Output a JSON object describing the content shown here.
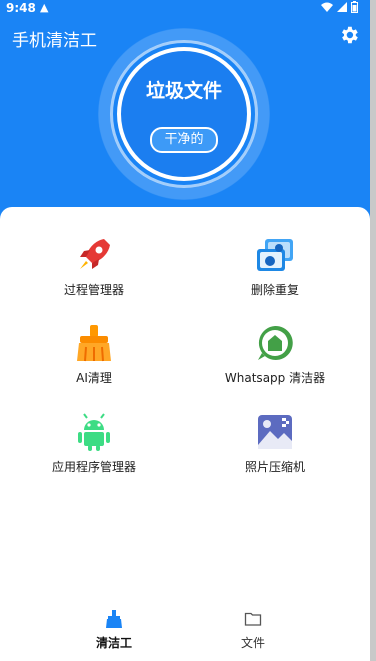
{
  "status": {
    "time": "9:48",
    "alert": "▲"
  },
  "app": {
    "title": "手机清洁工"
  },
  "hero": {
    "title": "垃圾文件",
    "status": "干净的"
  },
  "tools": [
    {
      "label": "过程管理器",
      "icon": "rocket-icon"
    },
    {
      "label": "删除重复",
      "icon": "duplicate-images-icon"
    },
    {
      "label": "AI清理",
      "icon": "broom-icon"
    },
    {
      "label": "Whatsapp 清洁器",
      "icon": "whatsapp-icon"
    },
    {
      "label": "应用程序管理器",
      "icon": "android-icon"
    },
    {
      "label": "照片压缩机",
      "icon": "photo-compress-icon"
    }
  ],
  "nav": [
    {
      "label": "清洁工",
      "icon": "broom-nav-icon",
      "active": true
    },
    {
      "label": "文件",
      "icon": "folder-icon",
      "active": false
    }
  ],
  "colors": {
    "primary": "#1a84f5",
    "background": "#ffffff"
  }
}
